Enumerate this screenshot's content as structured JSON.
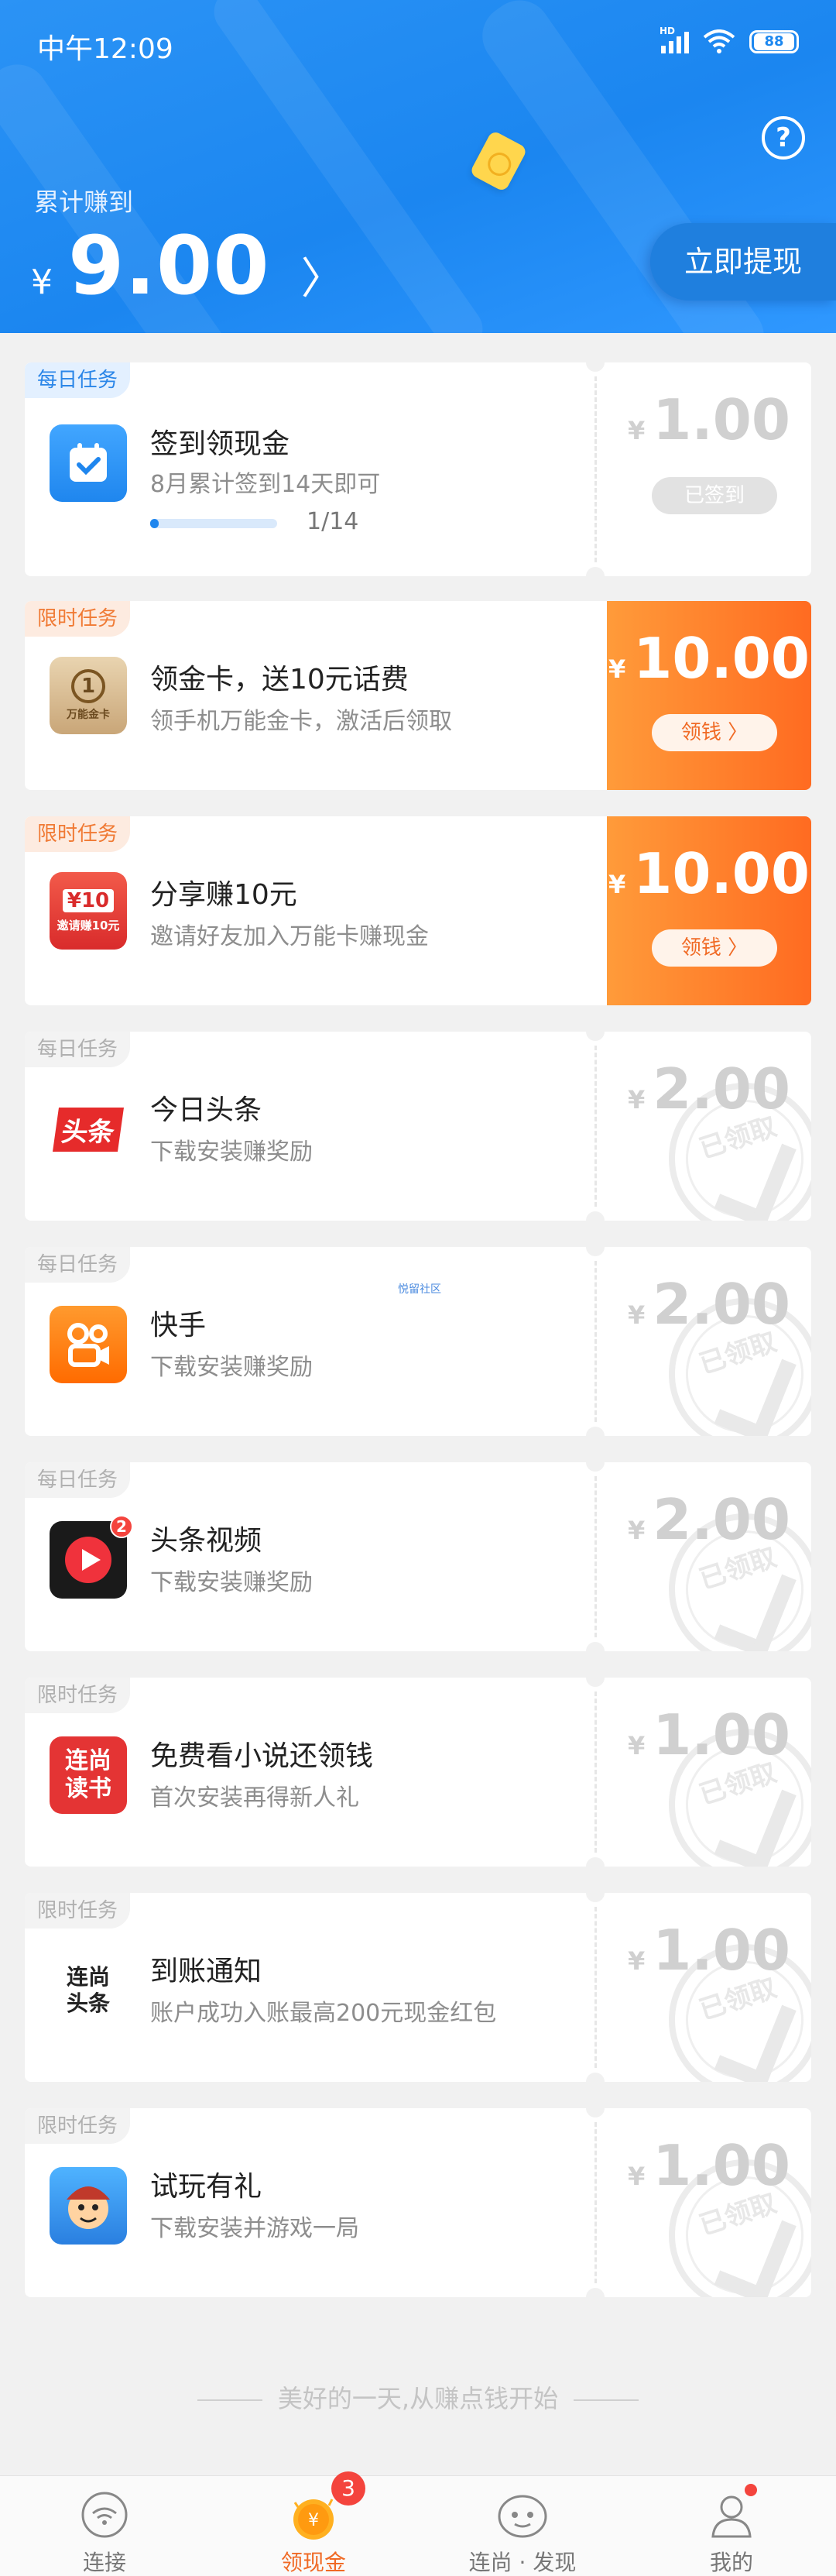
{
  "status_bar": {
    "time": "中午12:09",
    "battery": "88",
    "network": "HD"
  },
  "header": {
    "earned_label": "累计赚到",
    "currency": "¥",
    "amount": "9.00",
    "withdraw_label": "立即提现",
    "help_symbol": "?"
  },
  "tasks": [
    {
      "tag": "每日任务",
      "title": "签到领现金",
      "subtitle": "8月累计签到14天即可",
      "progress_text": "1/14",
      "progress": 0.07,
      "currency": "¥",
      "amount": "1.00",
      "action": "已签到",
      "icon": "calendar-check-icon"
    },
    {
      "tag": "限时任务",
      "title": "领金卡，送10元话费",
      "subtitle": "领手机万能金卡，激活后领取",
      "currency": "¥",
      "amount": "10.00",
      "action": "领钱",
      "action_arrow": "〉",
      "icon": "gold-card-icon",
      "icon_text": "万能金卡"
    },
    {
      "tag": "限时任务",
      "title": "分享赚10元",
      "subtitle": "邀请好友加入万能卡赚现金",
      "currency": "¥",
      "amount": "10.00",
      "action": "领钱",
      "action_arrow": "〉",
      "icon": "share-gift-icon",
      "icon_text": "邀请赚10元",
      "icon_num": "¥10"
    },
    {
      "tag": "每日任务",
      "title": "今日头条",
      "subtitle": "下载安装赚奖励",
      "currency": "¥",
      "amount": "2.00",
      "stamp": "已领取",
      "icon": "toutiao-icon",
      "icon_text": "头条"
    },
    {
      "tag": "每日任务",
      "title": "快手",
      "subtitle": "下载安装赚奖励",
      "currency": "¥",
      "amount": "2.00",
      "stamp": "已领取",
      "icon": "kuaishou-icon"
    },
    {
      "tag": "每日任务",
      "title": "头条视频",
      "subtitle": "下载安装赚奖励",
      "currency": "¥",
      "amount": "2.00",
      "stamp": "已领取",
      "icon": "toutiao-video-icon",
      "icon_badge": "2"
    },
    {
      "tag": "限时任务",
      "title": "免费看小说还领钱",
      "subtitle": "首次安装再得新人礼",
      "currency": "¥",
      "amount": "1.00",
      "stamp": "已领取",
      "icon": "novel-reader-icon",
      "icon_text": "连尚读书"
    },
    {
      "tag": "限时任务",
      "title": "到账通知",
      "subtitle": "账户成功入账最高200元现金红包",
      "currency": "¥",
      "amount": "1.00",
      "stamp": "已领取",
      "icon": "lianshang-toutiao-icon",
      "icon_text": "连尚头条"
    },
    {
      "tag": "限时任务",
      "title": "试玩有礼",
      "subtitle": "下载安装并游戏一局",
      "currency": "¥",
      "amount": "1.00",
      "stamp": "已领取",
      "icon": "game-character-icon"
    }
  ],
  "watermark": "悦留社区",
  "footer_slogan": "美好的一天,从赚点钱开始",
  "nav": [
    {
      "label": "连接",
      "icon": "wifi-icon"
    },
    {
      "label": "领现金",
      "icon": "coin-icon",
      "badge": "3",
      "active": true
    },
    {
      "label": "连尚 · 发现",
      "icon": "face-icon"
    },
    {
      "label": "我的",
      "icon": "person-icon",
      "dot": true
    }
  ],
  "colors": {
    "primary_blue": "#1f86ee",
    "orange": "#ff7a2a",
    "badge_red": "#f4443d"
  }
}
